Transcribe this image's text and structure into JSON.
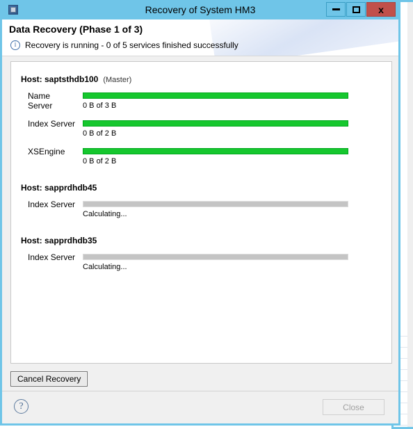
{
  "window": {
    "title": "Recovery of System HM3",
    "app_icon": "application-icon",
    "buttons": {
      "minimize": "–",
      "maximize": "□",
      "close": "x"
    }
  },
  "header": {
    "title": "Data Recovery (Phase 1 of 3)",
    "status_icon": "info-icon",
    "status_glyph": "i",
    "status_text": "Recovery is running - 0 of 5 services finished successfully"
  },
  "hosts": [
    {
      "name": "Host: saptsthdb100",
      "role": "(Master)",
      "services": [
        {
          "label": "Name Server",
          "state": "green",
          "caption": "0 B of 3 B"
        },
        {
          "label": "Index Server",
          "state": "green",
          "caption": "0 B of 2 B"
        },
        {
          "label": "XSEngine",
          "state": "green",
          "caption": "0 B of 2 B"
        }
      ]
    },
    {
      "name": "Host: sapprdhdb45",
      "role": "",
      "services": [
        {
          "label": "Index Server",
          "state": "idle",
          "caption": "Calculating..."
        }
      ]
    },
    {
      "name": "Host: sapprdhdb35",
      "role": "",
      "services": [
        {
          "label": "Index Server",
          "state": "idle",
          "caption": "Calculating..."
        }
      ]
    }
  ],
  "actions": {
    "cancel_recovery_label": "Cancel Recovery"
  },
  "footer": {
    "help_glyph": "?",
    "help_icon": "help-icon",
    "close_label": "Close"
  },
  "colors": {
    "title_bar": "#6fc5e8",
    "close_button": "#c1504a",
    "progress_green": "#16c72e",
    "progress_idle": "#c4c4c4",
    "info_blue": "#3f6fa8"
  }
}
